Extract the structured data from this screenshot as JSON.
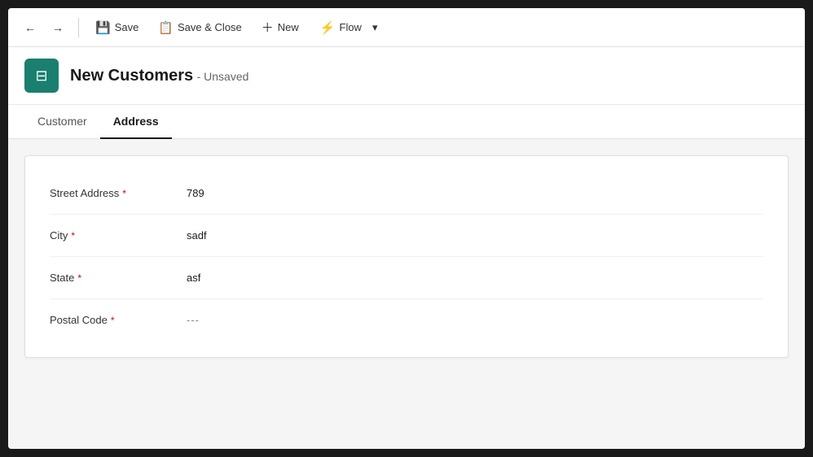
{
  "toolbar": {
    "back_label": "←",
    "forward_label": "→",
    "save_label": "Save",
    "save_close_label": "Save & Close",
    "new_label": "New",
    "flow_label": "Flow",
    "flow_chevron": "▾"
  },
  "header": {
    "icon": "🗂",
    "title": "New Customers",
    "status": "- Unsaved"
  },
  "tabs": [
    {
      "id": "customer",
      "label": "Customer",
      "active": false
    },
    {
      "id": "address",
      "label": "Address",
      "active": true
    }
  ],
  "form": {
    "fields": [
      {
        "id": "street-address",
        "label": "Street Address",
        "required": true,
        "value": "789",
        "empty": false
      },
      {
        "id": "city",
        "label": "City",
        "required": true,
        "value": "sadf",
        "empty": false
      },
      {
        "id": "state",
        "label": "State",
        "required": true,
        "value": "asf",
        "empty": false
      },
      {
        "id": "postal-code",
        "label": "Postal Code",
        "required": true,
        "value": "---",
        "empty": true
      }
    ]
  },
  "colors": {
    "accent": "#1a7f6e",
    "required": "#cc0000"
  }
}
